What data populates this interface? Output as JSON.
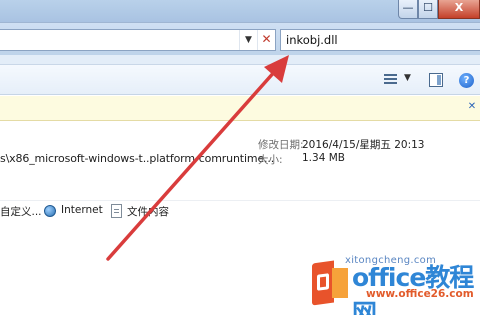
{
  "titlebar": {
    "minimize_label": "—",
    "maximize_label": "☐",
    "close_label": "X"
  },
  "address": {
    "value": ""
  },
  "search": {
    "value": "inkobj.dll"
  },
  "details": {
    "path": "s\\x86_microsoft-windows-t..platform-comruntime...",
    "modified_label": "修改日期:",
    "modified_value": "2016/4/15/星期五 20:13",
    "size_label": "大小:",
    "size_value": "1.34 MB"
  },
  "bottom_links": {
    "custom": "自定义...",
    "internet": "Internet",
    "file_contents": "文件内容"
  },
  "watermark": {
    "brand": "office教程网",
    "site": "www.office26.com",
    "sub": "xitongcheng.com"
  },
  "colors": {
    "arrow": "#d93c3c",
    "accent": "#2f86d6",
    "infobar": "#fdfbe0"
  },
  "icons": [
    "close-icon",
    "view-icon",
    "preview-pane-icon",
    "help-icon",
    "globe-icon",
    "document-icon",
    "office-logo-icon"
  ]
}
